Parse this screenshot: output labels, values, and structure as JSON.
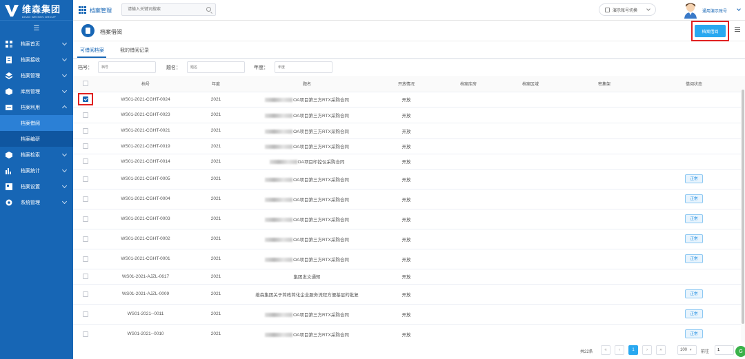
{
  "brand": {
    "name_cn": "维森集团",
    "name_en": "DEAO WEISEN GROUP"
  },
  "colors": {
    "primary": "#1766b5",
    "accent": "#29a8f0",
    "highlight": "#e02020"
  },
  "sidebar": {
    "items": [
      {
        "label": "档案首页",
        "icon": "home-icon"
      },
      {
        "label": "档案接收",
        "icon": "inbox-icon"
      },
      {
        "label": "档案管理",
        "icon": "layers-icon"
      },
      {
        "label": "库房管理",
        "icon": "box-icon"
      },
      {
        "label": "档案利用",
        "icon": "folder-icon",
        "expanded": true,
        "children": [
          {
            "label": "档案借阅",
            "active": true
          },
          {
            "label": "档案编研"
          }
        ]
      },
      {
        "label": "档案检索",
        "icon": "search-icon"
      },
      {
        "label": "档案统计",
        "icon": "chart-icon"
      },
      {
        "label": "档案设置",
        "icon": "settings-icon"
      },
      {
        "label": "系统管理",
        "icon": "gear-icon"
      }
    ]
  },
  "topbar": {
    "title": "档案管理",
    "search_placeholder": "请输入关键词搜索",
    "account_switch": "演示账号切换",
    "user_name": "通用演示账号"
  },
  "page": {
    "title": "档案借阅",
    "borrow_button": "档案借阅"
  },
  "tabs": [
    {
      "label": "可借阅档案",
      "active": true
    },
    {
      "label": "我的借阅记录"
    }
  ],
  "filters": [
    {
      "label": "档号：",
      "placeholder": "档号"
    },
    {
      "label": "题名：",
      "placeholder": "题名"
    },
    {
      "label": "年度：",
      "placeholder": "年度"
    }
  ],
  "table": {
    "columns": [
      "档号",
      "年度",
      "题名",
      "开放情况",
      "档案库房",
      "档案区域",
      "密集架",
      "借阅状态"
    ],
    "rows": [
      {
        "checked": true,
        "code": "WS01-2021-CGHT-0024",
        "year": "2021",
        "title": "OA项目第三方RTX采购合同",
        "open": "开放",
        "status": ""
      },
      {
        "checked": false,
        "code": "WS01-2021-CGHT-0023",
        "year": "2021",
        "title": "OA项目第三方RTX采购合同",
        "open": "开放",
        "status": ""
      },
      {
        "checked": false,
        "code": "WS01-2021-CGHT-0021",
        "year": "2021",
        "title": "OA项目第三方RTX采购合同",
        "open": "开放",
        "status": ""
      },
      {
        "checked": false,
        "code": "WS01-2021-CGHT-0019",
        "year": "2021",
        "title": "OA项目第三方RTX采购合同",
        "open": "开放",
        "status": ""
      },
      {
        "checked": false,
        "code": "WS01-2021-CGHT-0014",
        "year": "2021",
        "title": "OA项目印控仪采购合同",
        "open": "开放",
        "status": ""
      },
      {
        "checked": false,
        "code": "WS01-2021-CGHT-0005",
        "year": "2021",
        "title": "OA项目第三方RTX采购合同",
        "open": "开放",
        "status": "正常"
      },
      {
        "checked": false,
        "code": "WS01-2021-CGHT-0004",
        "year": "2021",
        "title": "OA项目第三方RTX采购合同",
        "open": "开放",
        "status": "正常"
      },
      {
        "checked": false,
        "code": "WS01-2021-CGHT-0003",
        "year": "2021",
        "title": "OA项目第三方RTX采购合同",
        "open": "开放",
        "status": "正常"
      },
      {
        "checked": false,
        "code": "WS01-2021-CGHT-0002",
        "year": "2021",
        "title": "OA项目第三方RTX采购合同",
        "open": "开放",
        "status": "正常"
      },
      {
        "checked": false,
        "code": "WS01-2021-CGHT-0001",
        "year": "2021",
        "title": "OA项目第三方RTX采购合同",
        "open": "开放",
        "status": "正常"
      },
      {
        "checked": false,
        "code": "WS01-2021-AJZL-0617",
        "year": "2021",
        "title": "集团发文通知",
        "open": "开放",
        "status": "",
        "noblur": true
      },
      {
        "checked": false,
        "code": "WS01-2021-AJZL-0009",
        "year": "2021",
        "title": "维森集团关于简政简化企业服务流程方便基层的批复",
        "open": "开放",
        "status": "正常",
        "noblur": true
      },
      {
        "checked": false,
        "code": "WS01-2021--0011",
        "year": "2021",
        "title": "OA项目第三方RTX采购合同",
        "open": "开放",
        "status": "正常"
      },
      {
        "checked": false,
        "code": "WS01-2021--0010",
        "year": "2021",
        "title": "OA项目第三方RTX采购合同",
        "open": "开放",
        "status": "正常"
      }
    ]
  },
  "pagination": {
    "total": "共22条",
    "current": "1",
    "page_size": "100",
    "goto_label": "前往",
    "goto_value": "1"
  }
}
